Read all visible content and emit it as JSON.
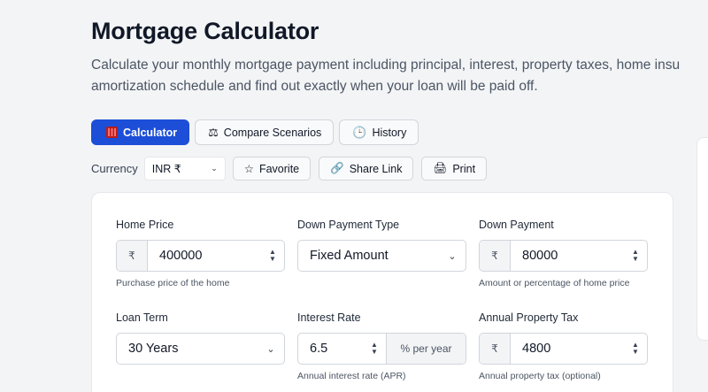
{
  "header": {
    "title": "Mortgage Calculator",
    "subtitle_line1": "Calculate your monthly mortgage payment including principal, interest, property taxes, home insu",
    "subtitle_line2": "amortization schedule and find out exactly when your loan will be paid off."
  },
  "tabs": [
    {
      "label": "Calculator",
      "icon": "calculator-icon",
      "active": true
    },
    {
      "label": "Compare Scenarios",
      "icon": "scale-icon",
      "active": false
    },
    {
      "label": "History",
      "icon": "clock-icon",
      "active": false
    }
  ],
  "toolbar": {
    "currency_label": "Currency",
    "currency_value": "INR ₹",
    "favorite_label": "Favorite",
    "share_label": "Share Link",
    "print_label": "Print"
  },
  "form": {
    "home_price": {
      "label": "Home Price",
      "prefix": "₹",
      "value": "400000",
      "help": "Purchase price of the home"
    },
    "down_payment_type": {
      "label": "Down Payment Type",
      "value": "Fixed Amount"
    },
    "down_payment": {
      "label": "Down Payment",
      "prefix": "₹",
      "value": "80000",
      "help": "Amount or percentage of home price"
    },
    "loan_term": {
      "label": "Loan Term",
      "value": "30 Years"
    },
    "interest_rate": {
      "label": "Interest Rate",
      "value": "6.5",
      "suffix": "% per year",
      "help": "Annual interest rate (APR)"
    },
    "property_tax": {
      "label": "Annual Property Tax",
      "prefix": "₹",
      "value": "4800",
      "help": "Annual property tax (optional)"
    }
  },
  "colors": {
    "accent": "#1d4ed8",
    "background": "#f3f4f6"
  }
}
